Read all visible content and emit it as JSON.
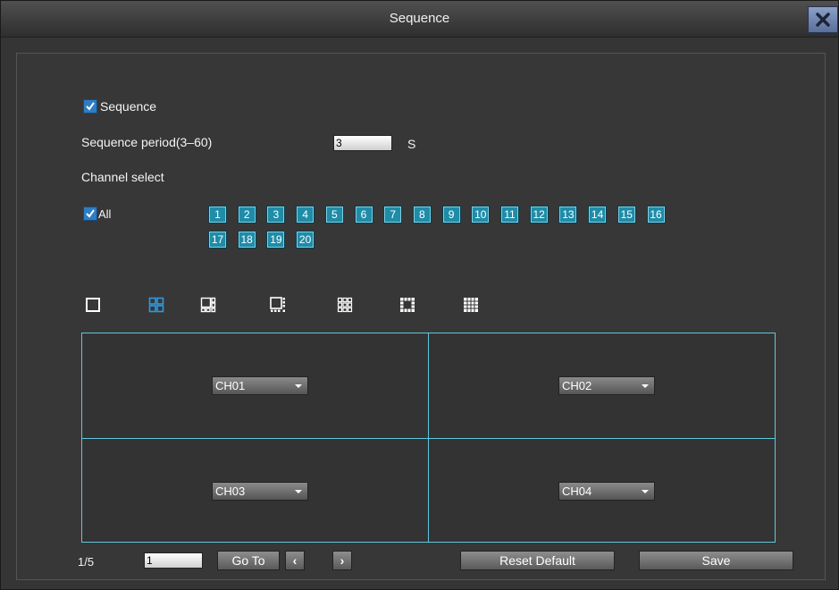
{
  "window": {
    "title": "Sequence"
  },
  "sequence": {
    "label": "Sequence",
    "checked": true
  },
  "period": {
    "label": "Sequence period(3–60)",
    "value": "3",
    "unit": "S"
  },
  "channel_select": {
    "label": "Channel select",
    "all_label": "All",
    "channels": [
      "1",
      "2",
      "3",
      "4",
      "5",
      "6",
      "7",
      "8",
      "9",
      "10",
      "11",
      "12",
      "13",
      "14",
      "15",
      "16",
      "17",
      "18",
      "19",
      "20"
    ]
  },
  "layouts": [
    "single-view-icon",
    "quad-view-icon",
    "six-view-icon",
    "eight-view-icon",
    "nine-view-icon",
    "thirteen-view-icon",
    "sixteen-view-icon"
  ],
  "grid_cells": [
    {
      "channel": "CH01"
    },
    {
      "channel": "CH02"
    },
    {
      "channel": "CH03"
    },
    {
      "channel": "CH04"
    }
  ],
  "pagination": {
    "page": "1/5",
    "input_value": "1",
    "goto_label": "Go To",
    "prev": "‹",
    "next": "›"
  },
  "actions": {
    "reset_label": "Reset Default",
    "save_label": "Save"
  },
  "colors": {
    "accent": "#1f8ca8",
    "grid_border": "#5ec8dc",
    "checkbox": "#2d7dc4"
  }
}
